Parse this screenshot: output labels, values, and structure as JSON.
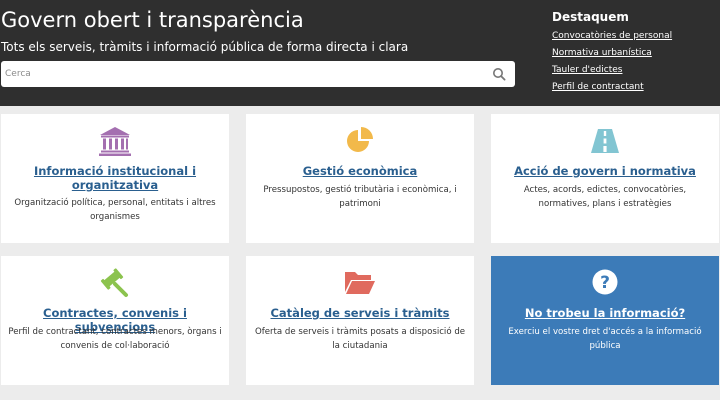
{
  "header": {
    "title": "Govern obert i transparència",
    "subtitle": "Tots els serveis, tràmits i informació pública de forma directa i clara",
    "search_placeholder": "Cerca"
  },
  "featured": {
    "title": "Destaquem",
    "links": [
      "Convocatòries de personal",
      "Normativa urbanística",
      "Tauler d'edictes",
      "Perfil de contractant"
    ]
  },
  "cards": [
    {
      "icon": "institution-icon",
      "title": "Informació institucional i organitzativa",
      "desc": "Organització política, personal, entitats i altres organismes"
    },
    {
      "icon": "pie-chart-icon",
      "title": "Gestió econòmica",
      "desc": "Pressupostos, gestió tributària i econòmica, i patrimoni"
    },
    {
      "icon": "road-icon",
      "title": "Acció de govern i normativa",
      "desc": "Actes, acords, edictes, convocatòries, normatives, plans i estratègies"
    },
    {
      "icon": "gavel-icon",
      "title": "Contractes, convenis i subvencions",
      "desc": "Perfil de contractant, contractes menors, òrgans i convenis de col·laboració"
    },
    {
      "icon": "folder-open-icon",
      "title": "Catàleg de serveis i tràmits",
      "desc": "Oferta de serveis i tràmits posats a disposició de la ciutadania"
    },
    {
      "icon": "question-circle-icon",
      "title": "No trobeu la informació?",
      "desc": "Exerciu el vostre dret d'accés a la informació pública"
    }
  ],
  "colors": {
    "header_bg": "#2f2f2f",
    "link_blue": "#2a5f8f",
    "institution_purple": "#a46fb0",
    "pie_orange": "#f2b94a",
    "road_teal": "#82c5d2",
    "gavel_green": "#8cc34e",
    "folder_red": "#e06a5e",
    "help_card_blue": "#3c7bb8"
  }
}
